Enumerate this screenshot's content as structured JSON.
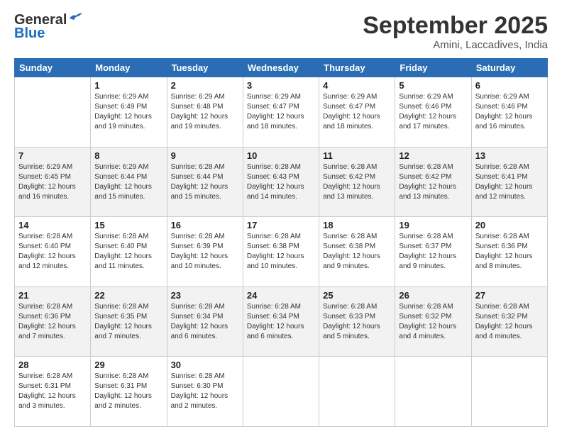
{
  "header": {
    "logo_general": "General",
    "logo_blue": "Blue",
    "title": "September 2025",
    "subtitle": "Amini, Laccadives, India"
  },
  "days_of_week": [
    "Sunday",
    "Monday",
    "Tuesday",
    "Wednesday",
    "Thursday",
    "Friday",
    "Saturday"
  ],
  "weeks": [
    [
      {
        "day": "",
        "sunrise": "",
        "sunset": "",
        "daylight": ""
      },
      {
        "day": "1",
        "sunrise": "Sunrise: 6:29 AM",
        "sunset": "Sunset: 6:49 PM",
        "daylight": "Daylight: 12 hours and 19 minutes."
      },
      {
        "day": "2",
        "sunrise": "Sunrise: 6:29 AM",
        "sunset": "Sunset: 6:48 PM",
        "daylight": "Daylight: 12 hours and 19 minutes."
      },
      {
        "day": "3",
        "sunrise": "Sunrise: 6:29 AM",
        "sunset": "Sunset: 6:47 PM",
        "daylight": "Daylight: 12 hours and 18 minutes."
      },
      {
        "day": "4",
        "sunrise": "Sunrise: 6:29 AM",
        "sunset": "Sunset: 6:47 PM",
        "daylight": "Daylight: 12 hours and 18 minutes."
      },
      {
        "day": "5",
        "sunrise": "Sunrise: 6:29 AM",
        "sunset": "Sunset: 6:46 PM",
        "daylight": "Daylight: 12 hours and 17 minutes."
      },
      {
        "day": "6",
        "sunrise": "Sunrise: 6:29 AM",
        "sunset": "Sunset: 6:46 PM",
        "daylight": "Daylight: 12 hours and 16 minutes."
      }
    ],
    [
      {
        "day": "7",
        "sunrise": "Sunrise: 6:29 AM",
        "sunset": "Sunset: 6:45 PM",
        "daylight": "Daylight: 12 hours and 16 minutes."
      },
      {
        "day": "8",
        "sunrise": "Sunrise: 6:29 AM",
        "sunset": "Sunset: 6:44 PM",
        "daylight": "Daylight: 12 hours and 15 minutes."
      },
      {
        "day": "9",
        "sunrise": "Sunrise: 6:28 AM",
        "sunset": "Sunset: 6:44 PM",
        "daylight": "Daylight: 12 hours and 15 minutes."
      },
      {
        "day": "10",
        "sunrise": "Sunrise: 6:28 AM",
        "sunset": "Sunset: 6:43 PM",
        "daylight": "Daylight: 12 hours and 14 minutes."
      },
      {
        "day": "11",
        "sunrise": "Sunrise: 6:28 AM",
        "sunset": "Sunset: 6:42 PM",
        "daylight": "Daylight: 12 hours and 13 minutes."
      },
      {
        "day": "12",
        "sunrise": "Sunrise: 6:28 AM",
        "sunset": "Sunset: 6:42 PM",
        "daylight": "Daylight: 12 hours and 13 minutes."
      },
      {
        "day": "13",
        "sunrise": "Sunrise: 6:28 AM",
        "sunset": "Sunset: 6:41 PM",
        "daylight": "Daylight: 12 hours and 12 minutes."
      }
    ],
    [
      {
        "day": "14",
        "sunrise": "Sunrise: 6:28 AM",
        "sunset": "Sunset: 6:40 PM",
        "daylight": "Daylight: 12 hours and 12 minutes."
      },
      {
        "day": "15",
        "sunrise": "Sunrise: 6:28 AM",
        "sunset": "Sunset: 6:40 PM",
        "daylight": "Daylight: 12 hours and 11 minutes."
      },
      {
        "day": "16",
        "sunrise": "Sunrise: 6:28 AM",
        "sunset": "Sunset: 6:39 PM",
        "daylight": "Daylight: 12 hours and 10 minutes."
      },
      {
        "day": "17",
        "sunrise": "Sunrise: 6:28 AM",
        "sunset": "Sunset: 6:38 PM",
        "daylight": "Daylight: 12 hours and 10 minutes."
      },
      {
        "day": "18",
        "sunrise": "Sunrise: 6:28 AM",
        "sunset": "Sunset: 6:38 PM",
        "daylight": "Daylight: 12 hours and 9 minutes."
      },
      {
        "day": "19",
        "sunrise": "Sunrise: 6:28 AM",
        "sunset": "Sunset: 6:37 PM",
        "daylight": "Daylight: 12 hours and 9 minutes."
      },
      {
        "day": "20",
        "sunrise": "Sunrise: 6:28 AM",
        "sunset": "Sunset: 6:36 PM",
        "daylight": "Daylight: 12 hours and 8 minutes."
      }
    ],
    [
      {
        "day": "21",
        "sunrise": "Sunrise: 6:28 AM",
        "sunset": "Sunset: 6:36 PM",
        "daylight": "Daylight: 12 hours and 7 minutes."
      },
      {
        "day": "22",
        "sunrise": "Sunrise: 6:28 AM",
        "sunset": "Sunset: 6:35 PM",
        "daylight": "Daylight: 12 hours and 7 minutes."
      },
      {
        "day": "23",
        "sunrise": "Sunrise: 6:28 AM",
        "sunset": "Sunset: 6:34 PM",
        "daylight": "Daylight: 12 hours and 6 minutes."
      },
      {
        "day": "24",
        "sunrise": "Sunrise: 6:28 AM",
        "sunset": "Sunset: 6:34 PM",
        "daylight": "Daylight: 12 hours and 6 minutes."
      },
      {
        "day": "25",
        "sunrise": "Sunrise: 6:28 AM",
        "sunset": "Sunset: 6:33 PM",
        "daylight": "Daylight: 12 hours and 5 minutes."
      },
      {
        "day": "26",
        "sunrise": "Sunrise: 6:28 AM",
        "sunset": "Sunset: 6:32 PM",
        "daylight": "Daylight: 12 hours and 4 minutes."
      },
      {
        "day": "27",
        "sunrise": "Sunrise: 6:28 AM",
        "sunset": "Sunset: 6:32 PM",
        "daylight": "Daylight: 12 hours and 4 minutes."
      }
    ],
    [
      {
        "day": "28",
        "sunrise": "Sunrise: 6:28 AM",
        "sunset": "Sunset: 6:31 PM",
        "daylight": "Daylight: 12 hours and 3 minutes."
      },
      {
        "day": "29",
        "sunrise": "Sunrise: 6:28 AM",
        "sunset": "Sunset: 6:31 PM",
        "daylight": "Daylight: 12 hours and 2 minutes."
      },
      {
        "day": "30",
        "sunrise": "Sunrise: 6:28 AM",
        "sunset": "Sunset: 6:30 PM",
        "daylight": "Daylight: 12 hours and 2 minutes."
      },
      {
        "day": "",
        "sunrise": "",
        "sunset": "",
        "daylight": ""
      },
      {
        "day": "",
        "sunrise": "",
        "sunset": "",
        "daylight": ""
      },
      {
        "day": "",
        "sunrise": "",
        "sunset": "",
        "daylight": ""
      },
      {
        "day": "",
        "sunrise": "",
        "sunset": "",
        "daylight": ""
      }
    ]
  ]
}
